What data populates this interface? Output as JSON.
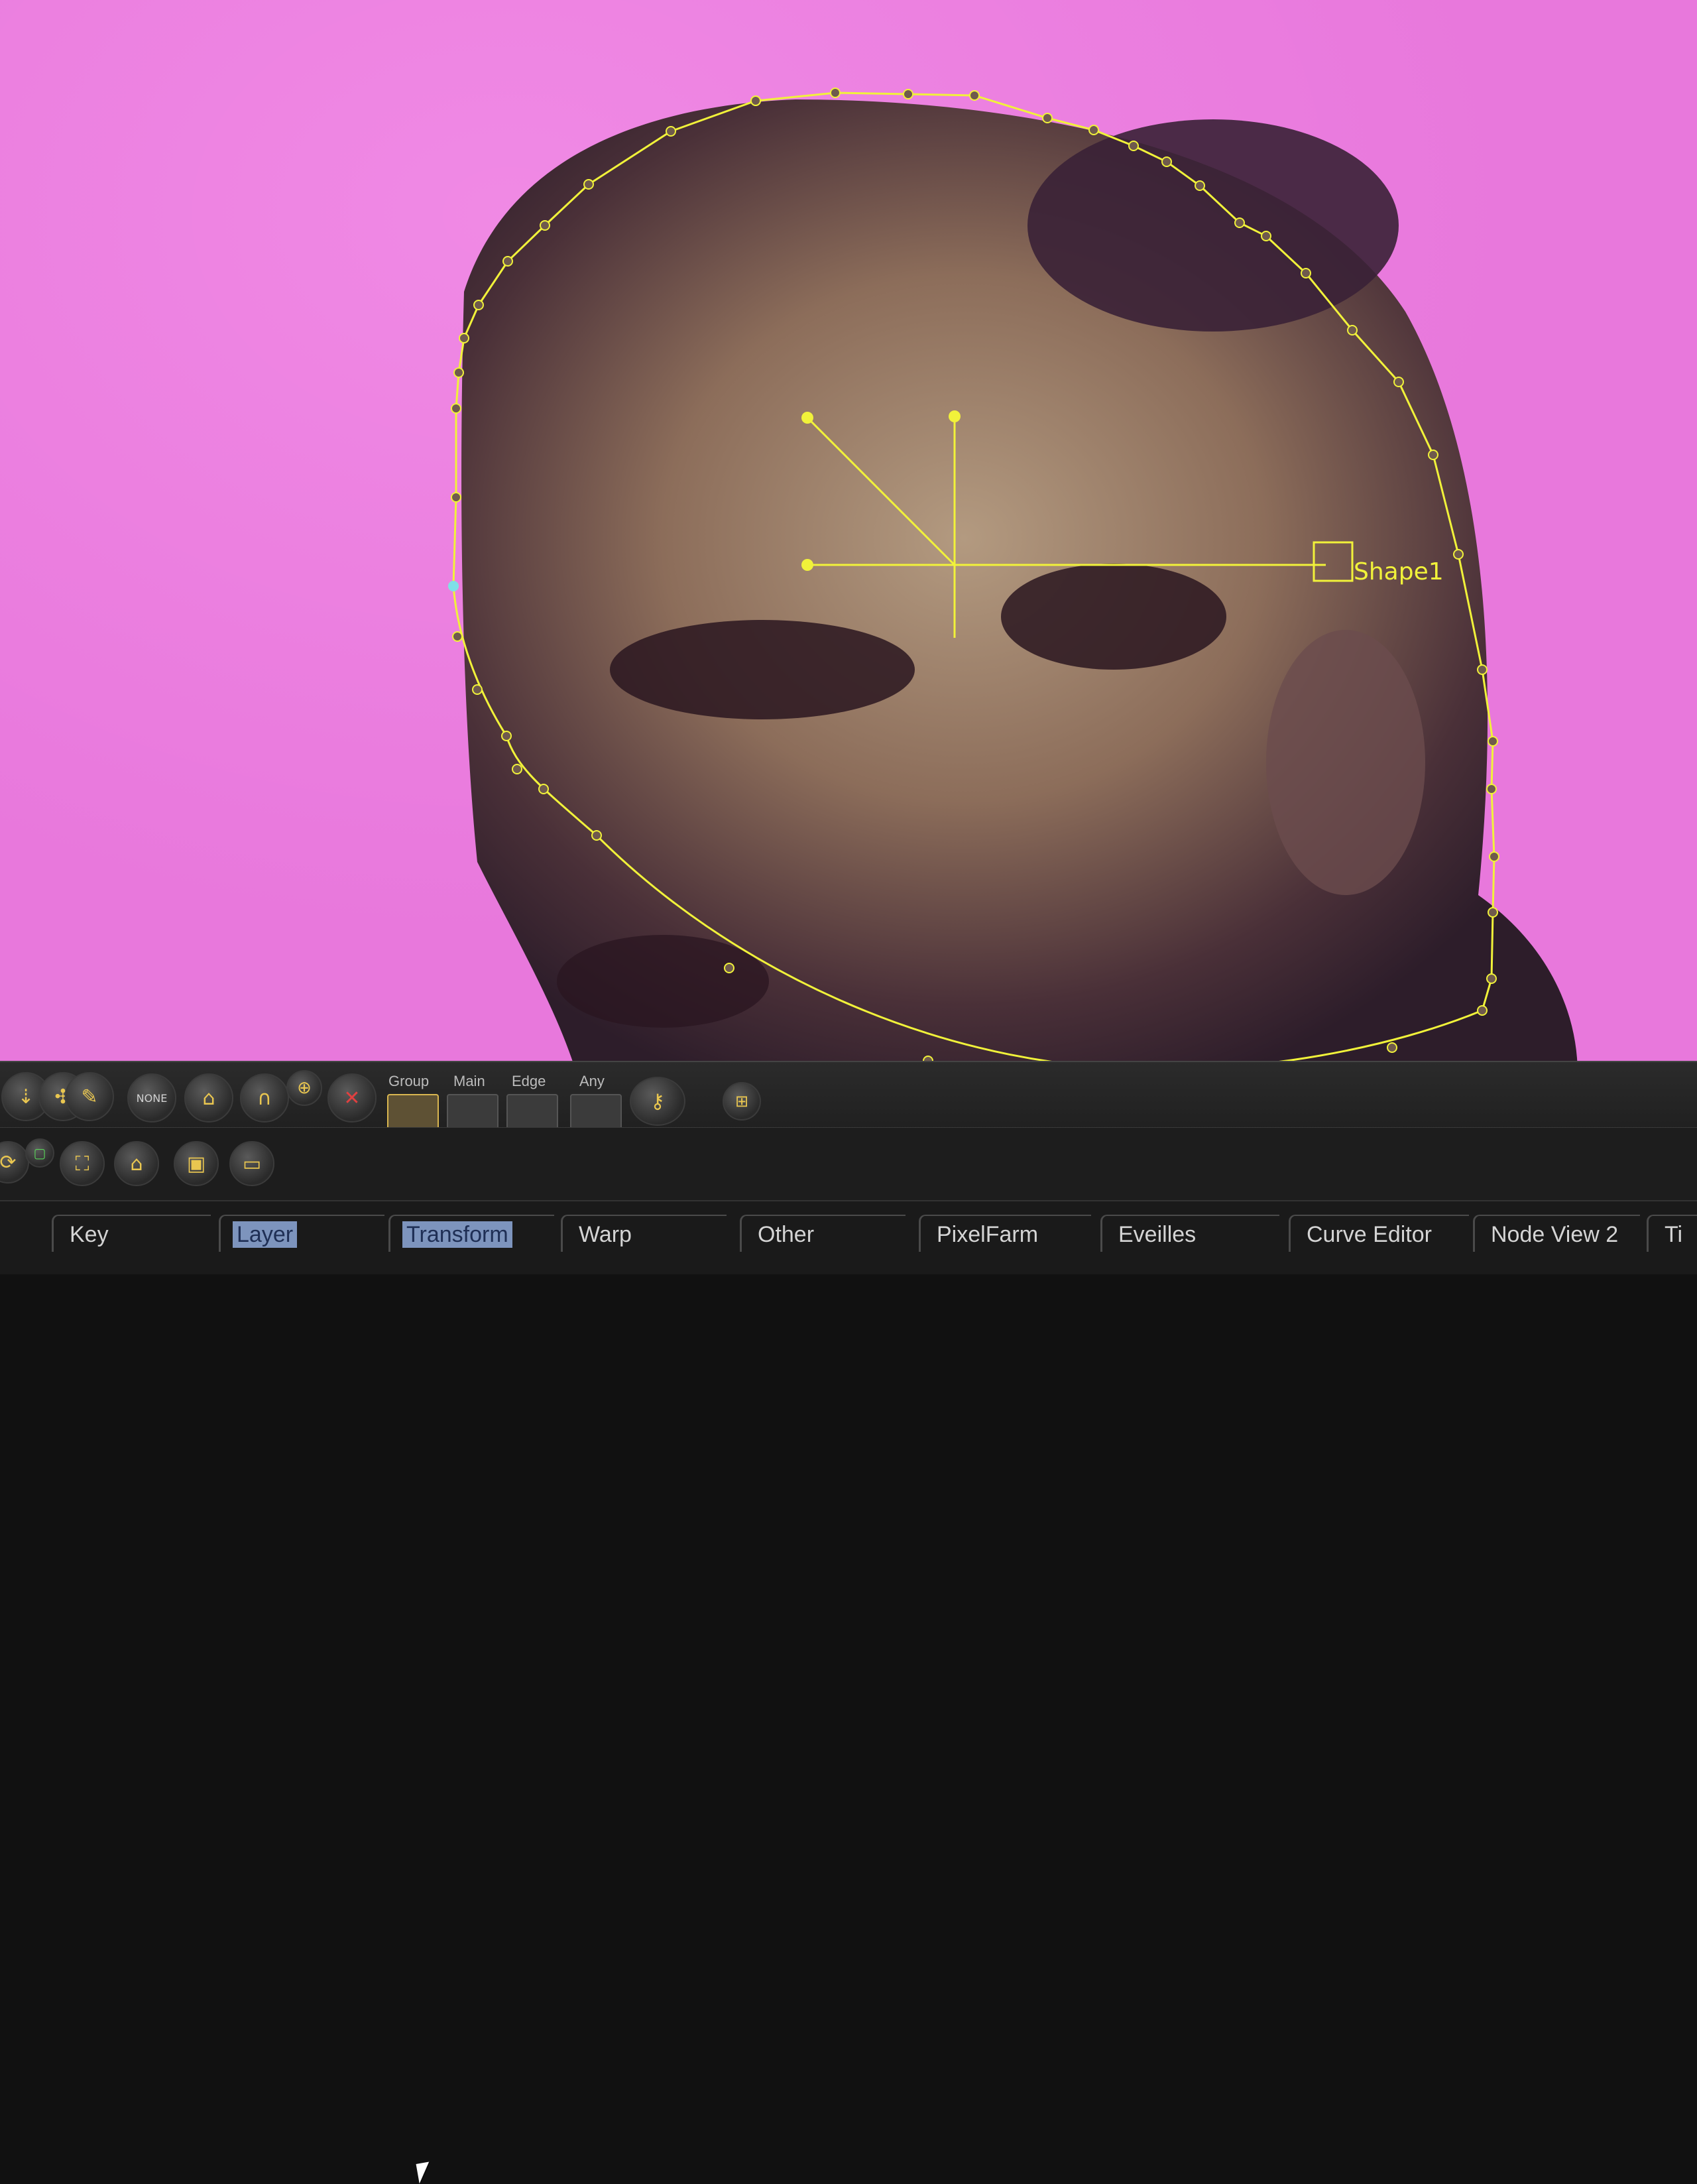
{
  "viewer": {
    "background_color": "#e878dc",
    "roto_color": "#f1f23a",
    "shape_label": "Shape1"
  },
  "toolbar": {
    "mode_labels": {
      "group": "Group",
      "main": "Main",
      "edge": "Edge",
      "any": "Any"
    },
    "icons": [
      "point-tools-icon",
      "select-tools-icon",
      "bezier-tool-icon",
      "select-none-icon",
      "lock-icon",
      "curve-icon",
      "target-icon",
      "delete-icon",
      "key-animate-icon",
      "grid-icon"
    ],
    "secondary_icons": [
      "refresh-icon",
      "layer-toggle-icon",
      "frame-icon",
      "home-icon",
      "box-icon",
      "rectangle-icon"
    ]
  },
  "tabs": [
    {
      "label": "Key",
      "highlight": false
    },
    {
      "label": "Layer",
      "highlight": true
    },
    {
      "label": "Transform",
      "highlight": true
    },
    {
      "label": "Warp",
      "highlight": false
    },
    {
      "label": "Other",
      "highlight": false
    },
    {
      "label": "PixelFarm",
      "highlight": false
    },
    {
      "label": "Eveilles",
      "highlight": false
    },
    {
      "label": "Curve Editor",
      "highlight": false
    },
    {
      "label": "Node View 2",
      "highlight": false
    },
    {
      "label": "Ti",
      "highlight": false
    }
  ]
}
